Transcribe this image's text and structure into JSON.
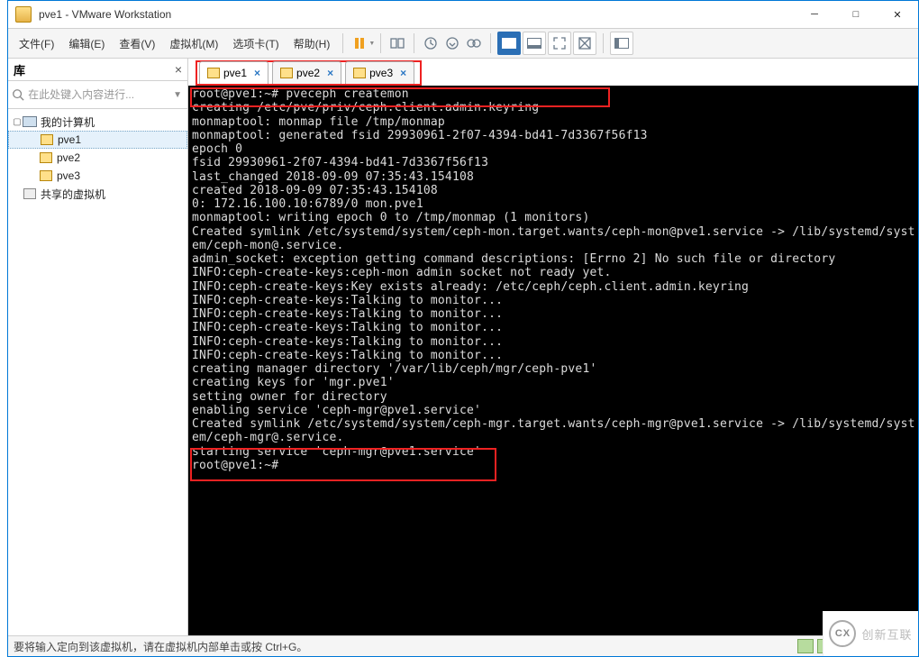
{
  "window": {
    "title": "pve1 - VMware Workstation"
  },
  "menu": {
    "file": "文件(F)",
    "edit": "编辑(E)",
    "view": "查看(V)",
    "vm": "虚拟机(M)",
    "tabs": "选项卡(T)",
    "help": "帮助(H)"
  },
  "sidebar": {
    "title": "库",
    "search_placeholder": "在此处键入内容进行...",
    "root": "我的计算机",
    "items": [
      {
        "label": "pve1",
        "selected": true
      },
      {
        "label": "pve2",
        "selected": false
      },
      {
        "label": "pve3",
        "selected": false
      }
    ],
    "shared": "共享的虚拟机"
  },
  "tabs": [
    {
      "label": "pve1",
      "active": true
    },
    {
      "label": "pve2",
      "active": false
    },
    {
      "label": "pve3",
      "active": false
    }
  ],
  "terminal": {
    "prompt_cmd": "root@pve1:~# pveceph createmon",
    "lines": [
      "creating /etc/pve/priv/ceph.client.admin.keyring",
      "monmaptool: monmap file /tmp/monmap",
      "monmaptool: generated fsid 29930961-2f07-4394-bd41-7d3367f56f13",
      "epoch 0",
      "fsid 29930961-2f07-4394-bd41-7d3367f56f13",
      "last_changed 2018-09-09 07:35:43.154108",
      "created 2018-09-09 07:35:43.154108",
      "0: 172.16.100.10:6789/0 mon.pve1",
      "monmaptool: writing epoch 0 to /tmp/monmap (1 monitors)",
      "Created symlink /etc/systemd/system/ceph-mon.target.wants/ceph-mon@pve1.service -> /lib/systemd/syst",
      "em/ceph-mon@.service.",
      "admin_socket: exception getting command descriptions: [Errno 2] No such file or directory",
      "INFO:ceph-create-keys:ceph-mon admin socket not ready yet.",
      "INFO:ceph-create-keys:Key exists already: /etc/ceph/ceph.client.admin.keyring",
      "INFO:ceph-create-keys:Talking to monitor...",
      "INFO:ceph-create-keys:Talking to monitor...",
      "INFO:ceph-create-keys:Talking to monitor...",
      "INFO:ceph-create-keys:Talking to monitor...",
      "INFO:ceph-create-keys:Talking to monitor...",
      "creating manager directory '/var/lib/ceph/mgr/ceph-pve1'",
      "creating keys for 'mgr.pve1'",
      "setting owner for directory",
      "enabling service 'ceph-mgr@pve1.service'",
      "Created symlink /etc/systemd/system/ceph-mgr.target.wants/ceph-mgr@pve1.service -> /lib/systemd/syst",
      "em/ceph-mgr@.service."
    ],
    "tail1": "starting service 'ceph-mgr@pve1.service'",
    "tail2": "root@pve1:~#"
  },
  "statusbar": {
    "text": "要将输入定向到该虚拟机，请在虚拟机内部单击或按 Ctrl+G。"
  },
  "watermark": "创新互联"
}
